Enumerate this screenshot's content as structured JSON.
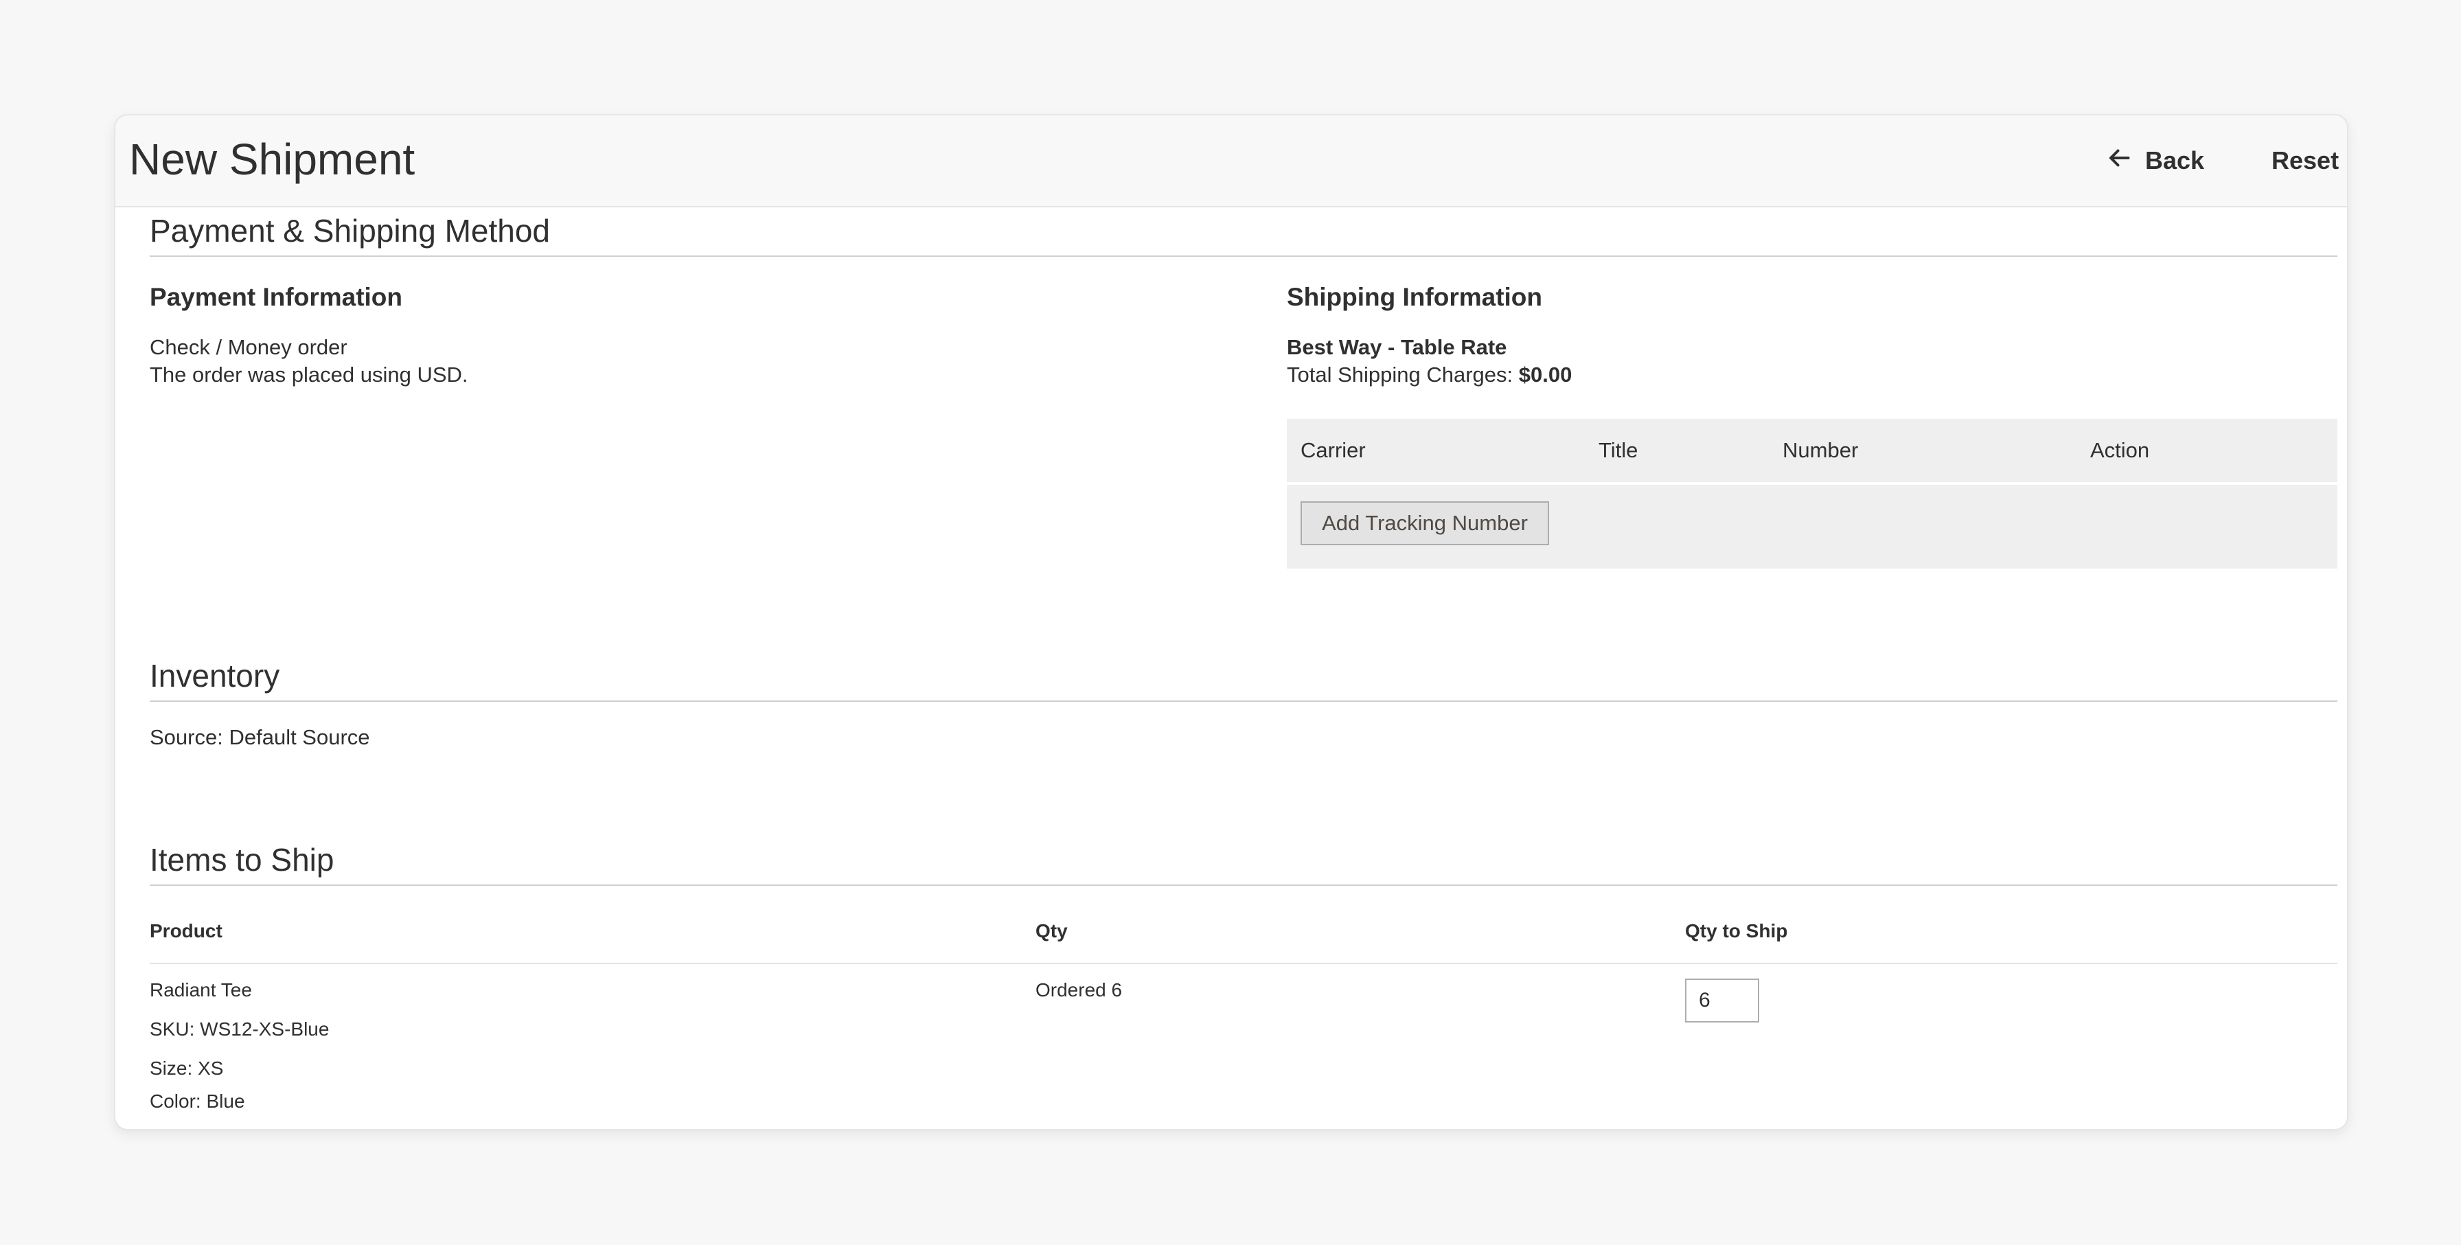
{
  "header": {
    "title": "New Shipment",
    "back_label": "Back",
    "reset_label": "Reset"
  },
  "payment_shipping": {
    "section_title": "Payment & Shipping Method",
    "payment": {
      "title": "Payment Information",
      "method": "Check / Money order",
      "currency_note": "The order was placed using USD."
    },
    "shipping": {
      "title": "Shipping Information",
      "method": "Best Way - Table Rate",
      "charges_label": "Total Shipping Charges:",
      "charges_value": "$0.00",
      "tracking_columns": [
        "Carrier",
        "Title",
        "Number",
        "Action"
      ],
      "add_tracking_label": "Add Tracking Number"
    }
  },
  "inventory": {
    "section_title": "Inventory",
    "source_label": "Source:",
    "source_value": "Default Source"
  },
  "items": {
    "section_title": "Items to Ship",
    "columns": [
      "Product",
      "Qty",
      "Qty to Ship"
    ],
    "rows": [
      {
        "name": "Radiant Tee",
        "sku_label": "SKU:",
        "sku": "WS12-XS-Blue",
        "size_label": "Size:",
        "size": "XS",
        "color_label": "Color:",
        "color": "Blue",
        "ordered_label": "Ordered",
        "ordered_qty": "6",
        "qty_to_ship": "6"
      }
    ]
  }
}
